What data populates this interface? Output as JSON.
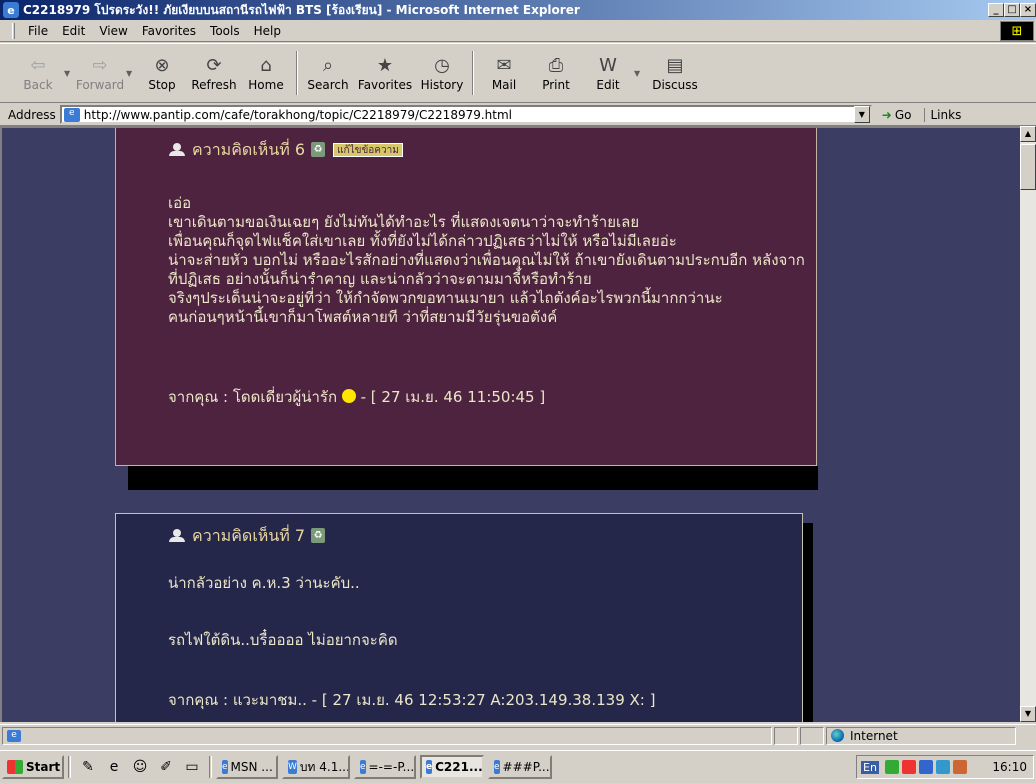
{
  "window": {
    "title": "C2218979 โปรดระวัง!! ภัยเงียบบนสถานีรถไฟฟ้า BTS [ร้องเรียน] - Microsoft Internet Explorer",
    "controls": {
      "minimize": "_",
      "maximize": "□",
      "close": "×"
    }
  },
  "menu": {
    "items": [
      "File",
      "Edit",
      "View",
      "Favorites",
      "Tools",
      "Help"
    ]
  },
  "toolbar": {
    "back": "Back",
    "forward": "Forward",
    "stop": "Stop",
    "refresh": "Refresh",
    "home": "Home",
    "search": "Search",
    "favorites": "Favorites",
    "history": "History",
    "mail": "Mail",
    "print": "Print",
    "edit": "Edit",
    "discuss": "Discuss"
  },
  "address": {
    "label": "Address",
    "url": "http://www.pantip.com/cafe/torakhong/topic/C2218979/C2218979.html",
    "go": "Go",
    "links": "Links"
  },
  "posts": [
    {
      "heading": "ความคิดเห็นที่ 6",
      "edit_badge": "แก้ไขข้อความ",
      "lines": [
        "เอ่อ",
        "เขาเดินตามขอเงินเฉยๆ ยังไม่ทันได้ทำอะไร ที่แสดงเจตนาว่าจะทำร้ายเลย",
        "เพื่อนคุณก็จุดไฟแช็คใส่เขาเลย ทั้งที่ยังไม่ได้กล่าวปฏิเสธว่าไม่ให้ หรือไม่มีเลยอ่ะ",
        "น่าจะส่ายหัว บอกไม่ หรืออะไรสักอย่างที่แสดงว่าเพื่อนคุณไม่ให้ ถ้าเขายังเดินตามประกบอีก หลังจาก",
        "ที่ปฏิเสธ อย่างนั้นก็น่ารำคาญ และน่ากลัวว่าจะตามมาจี้หรือทำร้าย",
        "จริงๆประเด็นน่าจะอยู่ที่ว่า ให้กำจัดพวกขอทานเมายา แล้วไถตังค์อะไรพวกนี้มากกว่านะ",
        "คนก่อนๆหน้านี้เขาก็มาโพสต์หลายที ว่าที่สยามมีวัยรุ่นขอตังค์"
      ],
      "footer_prefix": "จากคุณ : โดดเดี่ยวผู้น่ารัก",
      "footer_suffix": " - [ 27 เม.ย. 46 11:50:45 ]"
    },
    {
      "heading": "ความคิดเห็นที่ 7",
      "lines": [
        "น่ากลัวอย่าง ค.ห.3 ว่านะคับ..",
        "",
        "",
        "รถไฟใต้ดิน..บรื๋ออออ ไม่อยากจะคิด"
      ],
      "footer": "จากคุณ : แวะมาชม.. - [ 27 เม.ย. 46 12:53:27 A:203.149.38.139 X: ]"
    }
  ],
  "status": {
    "zone": "Internet"
  },
  "taskbar": {
    "start": "Start",
    "tasks": [
      "MSN ...",
      "บท 4.1...",
      "=-=-P...",
      "C221...",
      "###P..."
    ],
    "lang": "En",
    "clock": "16:10"
  }
}
